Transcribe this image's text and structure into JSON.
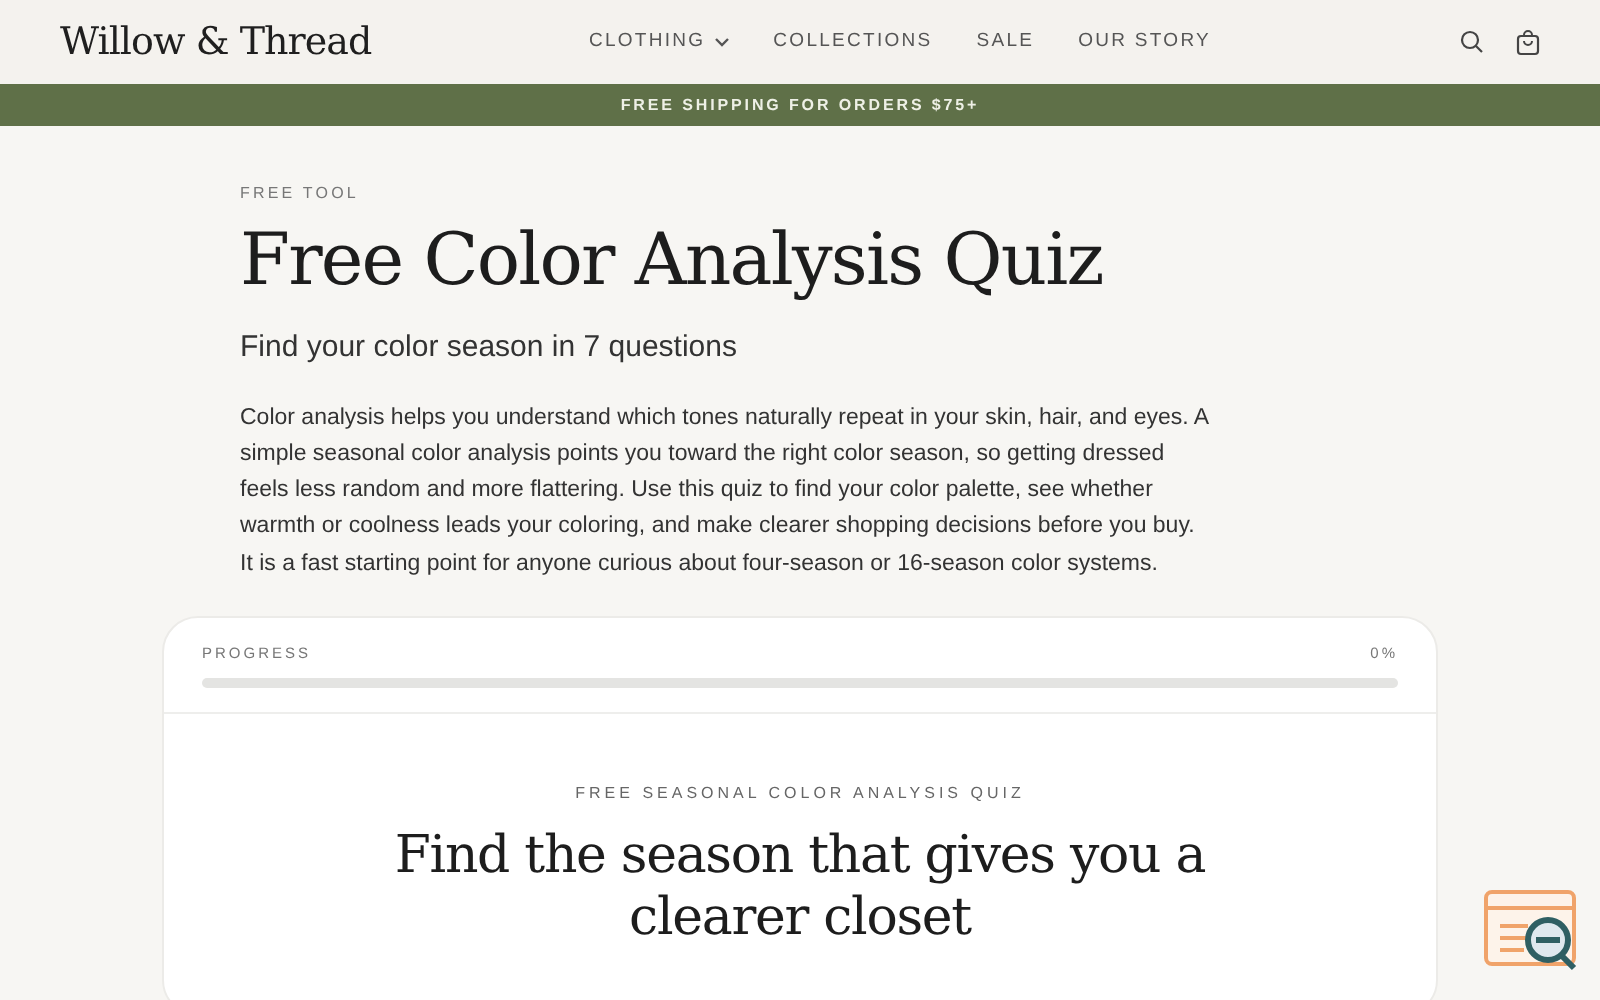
{
  "header": {
    "logo": "Willow & Thread",
    "nav": [
      {
        "label": "CLOTHING",
        "dropdown": true
      },
      {
        "label": "COLLECTIONS",
        "dropdown": false
      },
      {
        "label": "SALE",
        "dropdown": false
      },
      {
        "label": "OUR STORY",
        "dropdown": false
      }
    ]
  },
  "banner": "FREE SHIPPING FOR ORDERS $75+",
  "intro": {
    "eyebrow": "FREE TOOL",
    "title": "Free Color Analysis Quiz",
    "subtitle": "Find your color season in 7 questions",
    "body": "Color analysis helps you understand which tones naturally repeat in your skin, hair, and eyes. A simple seasonal color analysis points you toward the right color season, so getting dressed feels less random and more flattering. Use this quiz to find your color palette, see whether warmth or coolness leads your coloring, and make clearer shopping decisions before you buy. It is a fast starting point for anyone curious about four-season or 16-season color systems."
  },
  "quiz": {
    "progress_label": "PROGRESS",
    "progress_reading": "0%",
    "level": 0,
    "eyebrow": "FREE SEASONAL COLOR ANALYSIS QUIZ",
    "heading": "Find the season that gives you a clearer closet"
  }
}
